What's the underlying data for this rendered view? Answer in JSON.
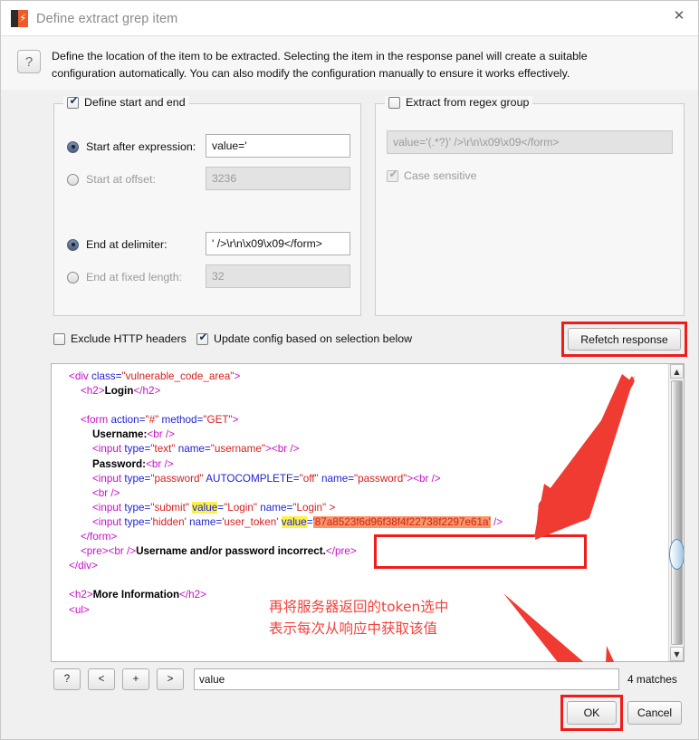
{
  "window": {
    "title": "Define extract grep item",
    "app_icon": "burp-suite-icon",
    "close_icon": "✕"
  },
  "description": {
    "help_icon": "?",
    "text": "Define the location of the item to be extracted. Selecting the item in the response panel will create a suitable configuration automatically. You can also modify the configuration manually to ensure it works effectively."
  },
  "start_end_group": {
    "legend": "Define start and end",
    "legend_checked": true,
    "rows": [
      {
        "label": "Start after expression:",
        "value": "value='",
        "selected": true,
        "disabled": false
      },
      {
        "label": "Start at offset:",
        "value": "3236",
        "selected": false,
        "disabled": true
      },
      {
        "label": "End at delimiter:",
        "value": "' />\\r\\n\\x09\\x09</form>",
        "selected": true,
        "disabled": false
      },
      {
        "label": "End at fixed length:",
        "value": "32",
        "selected": false,
        "disabled": true
      }
    ]
  },
  "regex_group": {
    "legend": "Extract from regex group",
    "legend_checked": false,
    "pattern": "value='(.*?)' />\\r\\n\\x09\\x09</form>",
    "case_sensitive_label": "Case sensitive",
    "case_sensitive_checked": true
  },
  "options": {
    "exclude_headers_label": "Exclude HTTP headers",
    "exclude_headers_checked": false,
    "update_config_label": "Update config based on selection below",
    "update_config_checked": true,
    "refetch_label": "Refetch response"
  },
  "response_code": {
    "lines": [
      [
        {
          "t": "    ",
          "c": ""
        },
        {
          "t": "<div ",
          "c": "tg"
        },
        {
          "t": "class=",
          "c": "at"
        },
        {
          "t": "\"vulnerable_code_area\"",
          "c": "vl"
        },
        {
          "t": ">",
          "c": "tg"
        }
      ],
      [
        {
          "t": "        ",
          "c": ""
        },
        {
          "t": "<h2>",
          "c": "tg"
        },
        {
          "t": "Login",
          "c": "bd"
        },
        {
          "t": "</h2>",
          "c": "tg"
        }
      ],
      [
        {
          "t": "",
          "c": ""
        }
      ],
      [
        {
          "t": "        ",
          "c": ""
        },
        {
          "t": "<form ",
          "c": "tg"
        },
        {
          "t": "action=",
          "c": "at"
        },
        {
          "t": "\"#\"",
          "c": "vl"
        },
        {
          "t": " method=",
          "c": "at"
        },
        {
          "t": "\"GET\"",
          "c": "vl"
        },
        {
          "t": ">",
          "c": "tg"
        }
      ],
      [
        {
          "t": "            ",
          "c": ""
        },
        {
          "t": "Username:",
          "c": "bd"
        },
        {
          "t": "<br />",
          "c": "tg"
        }
      ],
      [
        {
          "t": "            ",
          "c": ""
        },
        {
          "t": "<input ",
          "c": "tg"
        },
        {
          "t": "type=",
          "c": "at"
        },
        {
          "t": "\"text\"",
          "c": "vl"
        },
        {
          "t": " name=",
          "c": "at"
        },
        {
          "t": "\"username\"",
          "c": "vl"
        },
        {
          "t": ">",
          "c": "tg"
        },
        {
          "t": "<br />",
          "c": "tg"
        }
      ],
      [
        {
          "t": "            ",
          "c": ""
        },
        {
          "t": "Password:",
          "c": "bd"
        },
        {
          "t": "<br />",
          "c": "tg"
        }
      ],
      [
        {
          "t": "            ",
          "c": ""
        },
        {
          "t": "<input ",
          "c": "tg"
        },
        {
          "t": "type=",
          "c": "at"
        },
        {
          "t": "\"password\"",
          "c": "vl"
        },
        {
          "t": " AUTOCOMPLETE=",
          "c": "at"
        },
        {
          "t": "\"off\"",
          "c": "vl"
        },
        {
          "t": " name=",
          "c": "at"
        },
        {
          "t": "\"password\"",
          "c": "vl"
        },
        {
          "t": ">",
          "c": "tg"
        },
        {
          "t": "<br />",
          "c": "tg"
        }
      ],
      [
        {
          "t": "            ",
          "c": ""
        },
        {
          "t": "<br />",
          "c": "tg"
        }
      ],
      [
        {
          "t": "            ",
          "c": ""
        },
        {
          "t": "<input ",
          "c": "tg"
        },
        {
          "t": "type=",
          "c": "at"
        },
        {
          "t": "\"submit\"",
          "c": "vl"
        },
        {
          "t": " ",
          "c": ""
        },
        {
          "t": "value",
          "c": "at hl"
        },
        {
          "t": "=",
          "c": "at"
        },
        {
          "t": "\"Login\"",
          "c": "vl"
        },
        {
          "t": " name=",
          "c": "at"
        },
        {
          "t": "\"Login\" >",
          "c": "vl"
        }
      ],
      [
        {
          "t": "            ",
          "c": ""
        },
        {
          "t": "<input ",
          "c": "tg"
        },
        {
          "t": "type=",
          "c": "at"
        },
        {
          "t": "'hidden'",
          "c": "vl"
        },
        {
          "t": " name=",
          "c": "at"
        },
        {
          "t": "'user_token'",
          "c": "vl"
        },
        {
          "t": " ",
          "c": ""
        },
        {
          "t": "value",
          "c": "at hl"
        },
        {
          "t": "=",
          "c": "at"
        },
        {
          "t": "'87a8523f6d96f38f4f22738f2297e61a'",
          "c": "vl sel"
        },
        {
          "t": " />",
          "c": "tg"
        }
      ],
      [
        {
          "t": "        ",
          "c": ""
        },
        {
          "t": "</form>",
          "c": "tg"
        }
      ],
      [
        {
          "t": "        ",
          "c": ""
        },
        {
          "t": "<pre>",
          "c": "tg"
        },
        {
          "t": "<br />",
          "c": "tg"
        },
        {
          "t": "Username and/or password incorrect.",
          "c": "bd"
        },
        {
          "t": "</pre>",
          "c": "tg"
        }
      ],
      [
        {
          "t": "    ",
          "c": ""
        },
        {
          "t": "</div>",
          "c": "tg"
        }
      ],
      [
        {
          "t": "",
          "c": ""
        }
      ],
      [
        {
          "t": "    ",
          "c": ""
        },
        {
          "t": "<h2>",
          "c": "tg"
        },
        {
          "t": "More Information",
          "c": "bd"
        },
        {
          "t": "</h2>",
          "c": "tg"
        }
      ],
      [
        {
          "t": "    ",
          "c": ""
        },
        {
          "t": "<ul>",
          "c": "tg"
        }
      ]
    ],
    "scrollbar": {
      "up_icon": "▲",
      "down_icon": "▼"
    }
  },
  "annotation": {
    "chinese_note": "再将服务器返回的token选中\n表示每次从响应中获取该值",
    "color": "#f5403a"
  },
  "bottom_bar": {
    "buttons": [
      "?",
      "<",
      "+",
      ">"
    ],
    "search_value": "value",
    "matches_label": "4 matches",
    "ok_label": "OK",
    "cancel_label": "Cancel"
  }
}
